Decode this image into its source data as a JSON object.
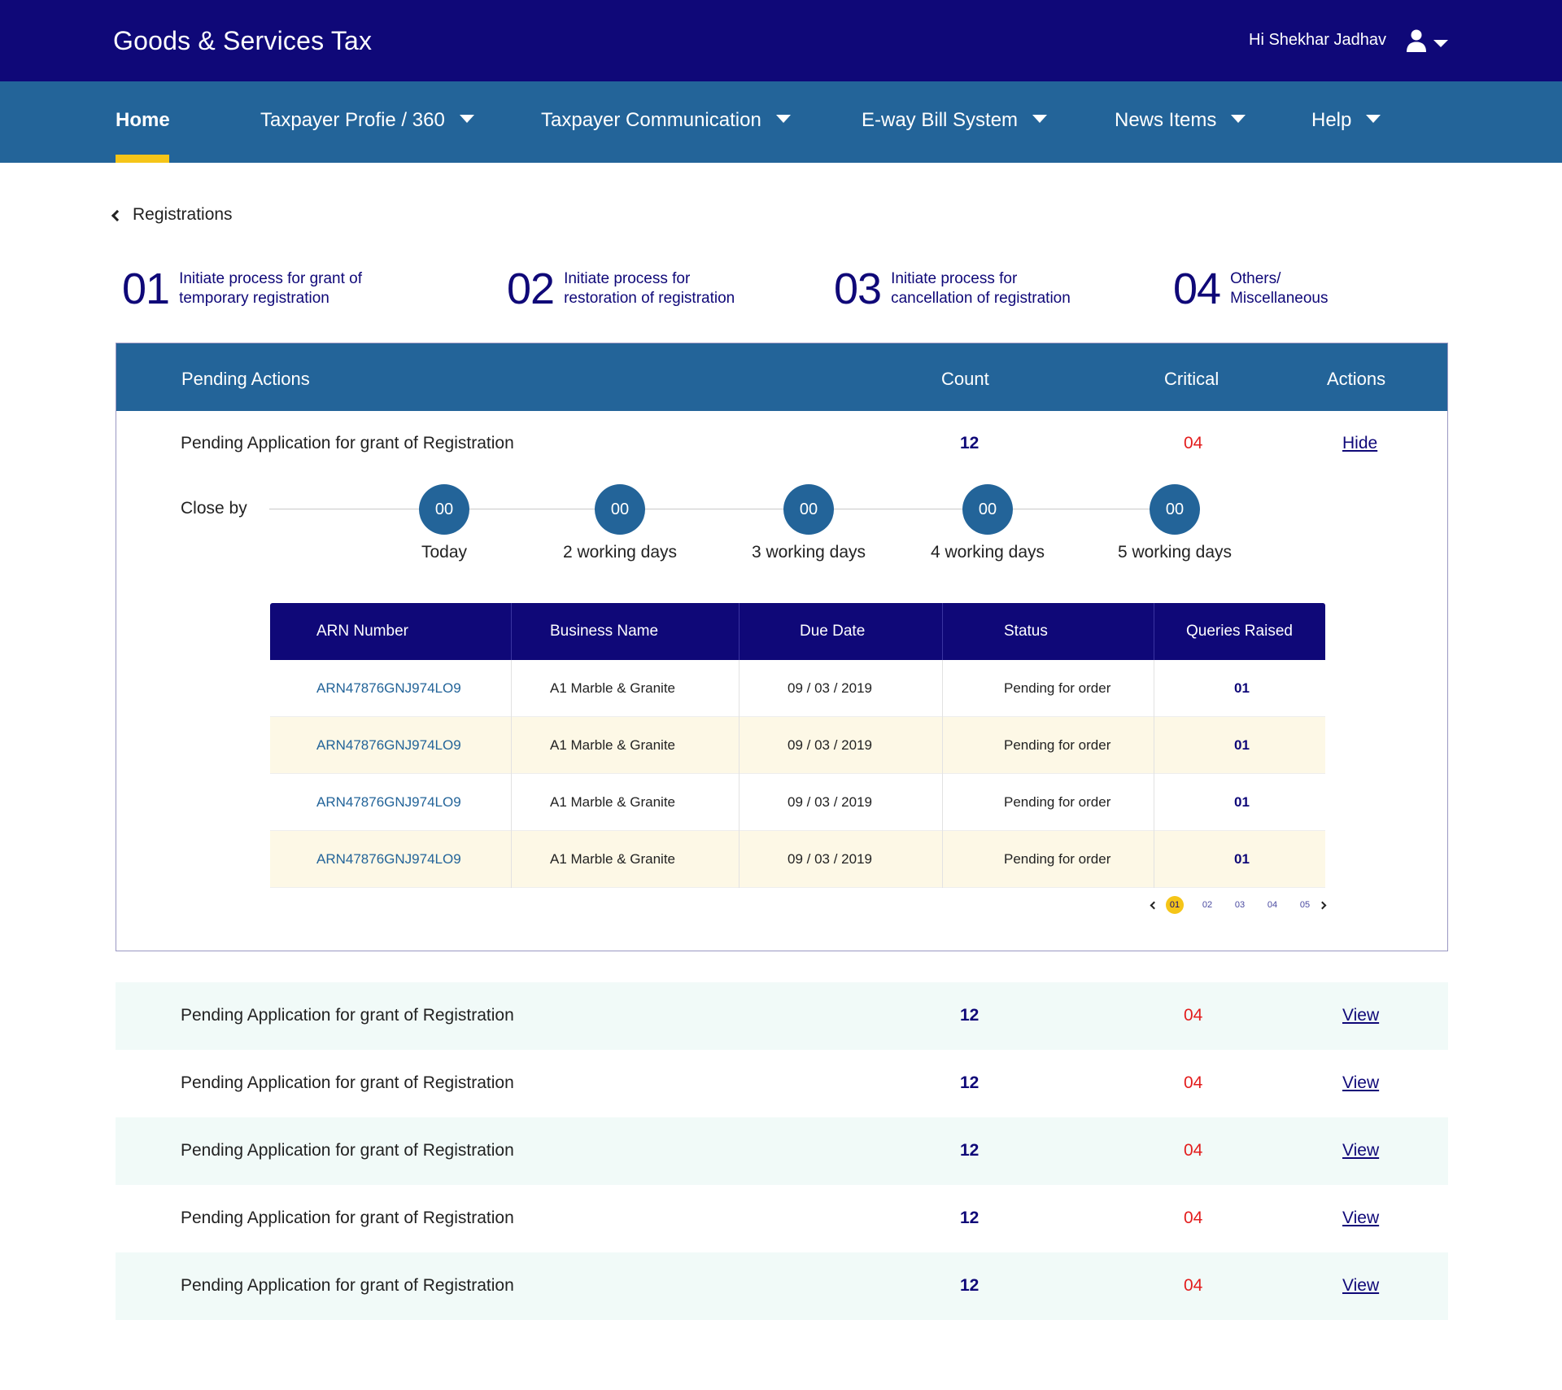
{
  "header": {
    "title": "Goods & Services Tax",
    "greeting": "Hi Shekhar Jadhav",
    "user_icon": "user-icon",
    "user_caret": "chevron-down-icon"
  },
  "nav": {
    "items": [
      {
        "label": "Home",
        "active": true
      },
      {
        "label": "Taxpayer Profie / 360",
        "active": false
      },
      {
        "label": "Taxpayer Communication",
        "active": false
      },
      {
        "label": "E-way Bill System",
        "active": false
      },
      {
        "label": "News Items",
        "active": false
      },
      {
        "label": "Help",
        "active": false
      }
    ]
  },
  "breadcrumb": {
    "label": "Registrations"
  },
  "quick_actions": [
    {
      "num": "01",
      "line1": "Initiate process for grant of",
      "line2": "temporary registration"
    },
    {
      "num": "02",
      "line1": "Initiate process for",
      "line2": "restoration of registration"
    },
    {
      "num": "03",
      "line1": "Initiate process for",
      "line2": "cancellation of registration"
    },
    {
      "num": "04",
      "line1": "Others/",
      "line2": "Miscellaneous"
    }
  ],
  "pending": {
    "headers": {
      "title": "Pending Actions",
      "count": "Count",
      "critical": "Critical",
      "actions": "Actions"
    },
    "expanded": {
      "label": "Pending Application for grant of Registration",
      "count": "12",
      "critical": "04",
      "action": "Hide",
      "close_by_label": "Close by",
      "close_by": [
        {
          "value": "00",
          "label": "Today"
        },
        {
          "value": "00",
          "label": "2 working days"
        },
        {
          "value": "00",
          "label": "3 working days"
        },
        {
          "value": "00",
          "label": "4 working days"
        },
        {
          "value": "00",
          "label": "5 working days"
        }
      ],
      "table": {
        "columns": [
          "ARN Number",
          "Business Name",
          "Due Date",
          "Status",
          "Queries Raised"
        ],
        "rows": [
          [
            "ARN47876GNJ974LO9",
            "A1 Marble & Granite",
            "09 / 03 / 2019",
            "Pending for order",
            "01"
          ],
          [
            "ARN47876GNJ974LO9",
            "A1 Marble & Granite",
            "09 / 03 / 2019",
            "Pending for order",
            "01"
          ],
          [
            "ARN47876GNJ974LO9",
            "A1 Marble & Granite",
            "09 / 03 / 2019",
            "Pending for order",
            "01"
          ],
          [
            "ARN47876GNJ974LO9",
            "A1 Marble & Granite",
            "09 / 03 / 2019",
            "Pending for order",
            "01"
          ]
        ]
      },
      "pagination": {
        "pages": [
          "01",
          "02",
          "03",
          "04",
          "05"
        ],
        "current": "01"
      }
    },
    "rows": [
      {
        "label": "Pending Application for grant of Registration",
        "count": "12",
        "critical": "04",
        "action": "View"
      },
      {
        "label": "Pending Application for grant of Registration",
        "count": "12",
        "critical": "04",
        "action": "View"
      },
      {
        "label": "Pending Application for grant of Registration",
        "count": "12",
        "critical": "04",
        "action": "View"
      },
      {
        "label": "Pending Application for grant of Registration",
        "count": "12",
        "critical": "04",
        "action": "View"
      },
      {
        "label": "Pending Application for grant of Registration",
        "count": "12",
        "critical": "04",
        "action": "View"
      }
    ]
  },
  "colors": {
    "header_bg": "#0f0878",
    "nav_bg": "#236499",
    "accent": "#f5c518",
    "critical": "#e31d1d",
    "row_alt": "#fdf8e6",
    "list_alt": "#f1faf8"
  }
}
